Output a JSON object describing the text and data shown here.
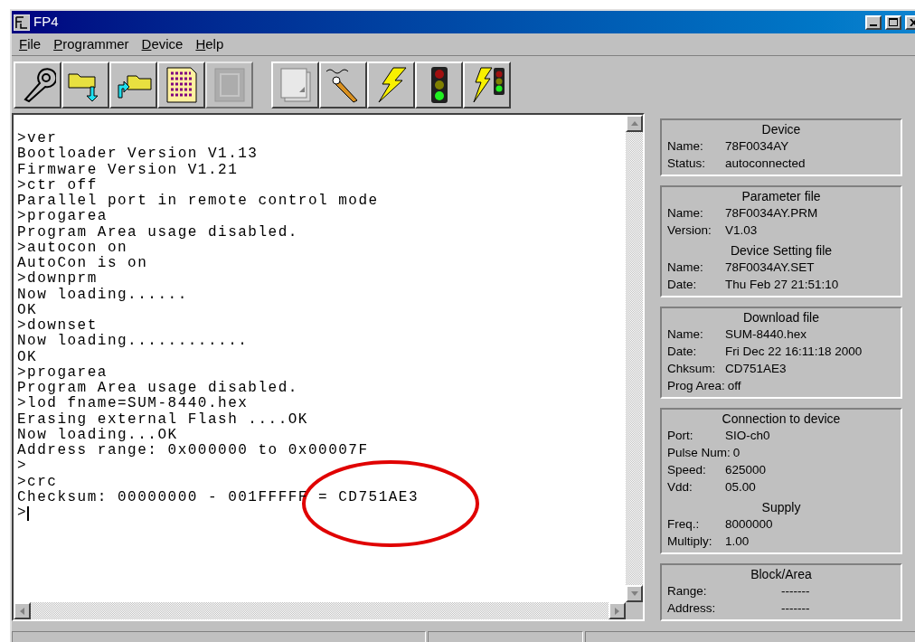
{
  "window": {
    "title": "FP4"
  },
  "menu": [
    {
      "label": "File"
    },
    {
      "label": "Programmer"
    },
    {
      "label": "Device"
    },
    {
      "label": "Help"
    }
  ],
  "toolbar": {
    "groups": [
      [
        {
          "disabled": false
        },
        {
          "disabled": false
        },
        {
          "disabled": false
        },
        {
          "disabled": false
        },
        {
          "disabled": true
        }
      ],
      [
        {
          "disabled": false
        },
        {
          "disabled": false
        },
        {
          "disabled": false
        },
        {
          "disabled": false
        },
        {
          "disabled": false
        }
      ]
    ]
  },
  "console": {
    "lines": [
      ">ver",
      "Bootloader Version V1.13",
      "Firmware Version V1.21",
      ">ctr off",
      "Parallel port in remote control mode",
      ">progarea",
      "Program Area usage disabled.",
      ">autocon on",
      "AutoCon is on",
      ">downprm",
      "Now loading......",
      "OK",
      ">downset",
      "Now loading............",
      "OK",
      ">progarea",
      "Program Area usage disabled.",
      ">lod fname=SUM-8440.hex",
      "Erasing external Flash ....OK",
      "Now loading...OK",
      "Address range: 0x000000 to 0x00007F",
      ">",
      ">crc",
      "Checksum: 00000000 - 001FFFFF = CD751AE3"
    ],
    "prompt": ">"
  },
  "info_panels": [
    {
      "sections": [
        {
          "heading": "Device",
          "indented_values": false,
          "rows": [
            {
              "label": "Name:",
              "value": "78F0034AY"
            },
            {
              "label": "Status:",
              "value": "autoconnected"
            }
          ]
        }
      ]
    },
    {
      "sections": [
        {
          "heading": "Parameter file",
          "indented_values": false,
          "rows": [
            {
              "label": "Name:",
              "value": "78F0034AY.PRM"
            },
            {
              "label": "Version:",
              "value": "V1.03"
            }
          ]
        },
        {
          "heading": "Device Setting file",
          "indented_values": false,
          "rows": [
            {
              "label": "Name:",
              "value": "78F0034AY.SET"
            },
            {
              "label": "Date:",
              "value": "Thu Feb 27 21:51:10"
            }
          ]
        }
      ]
    },
    {
      "sections": [
        {
          "heading": "Download file",
          "indented_values": false,
          "rows": [
            {
              "label": "Name:",
              "value": "SUM-8440.hex"
            },
            {
              "label": "Date:",
              "value": "Fri Dec 22 16:11:18 2000"
            },
            {
              "label": "Chksum:",
              "value": "CD751AE3"
            },
            {
              "label": "Prog Area:",
              "value": "off"
            }
          ]
        }
      ]
    },
    {
      "sections": [
        {
          "heading": "Connection to device",
          "indented_values": false,
          "rows": [
            {
              "label": "Port:",
              "value": "SIO-ch0"
            },
            {
              "label": "Pulse Num:",
              "value": "0"
            },
            {
              "label": "Speed:",
              "value": "625000"
            },
            {
              "label": "Vdd:",
              "value": "05.00"
            }
          ]
        },
        {
          "heading": "Supply",
          "indented_values": false,
          "rows": [
            {
              "label": "Freq.:",
              "value": "8000000"
            },
            {
              "label": "Multiply:",
              "value": "1.00"
            }
          ]
        }
      ]
    },
    {
      "sections": [
        {
          "heading": "Block/Area",
          "indented_values": true,
          "rows": [
            {
              "label": "Range:",
              "value": "-------"
            },
            {
              "label": "Address:",
              "value": "-------"
            }
          ]
        }
      ]
    }
  ]
}
